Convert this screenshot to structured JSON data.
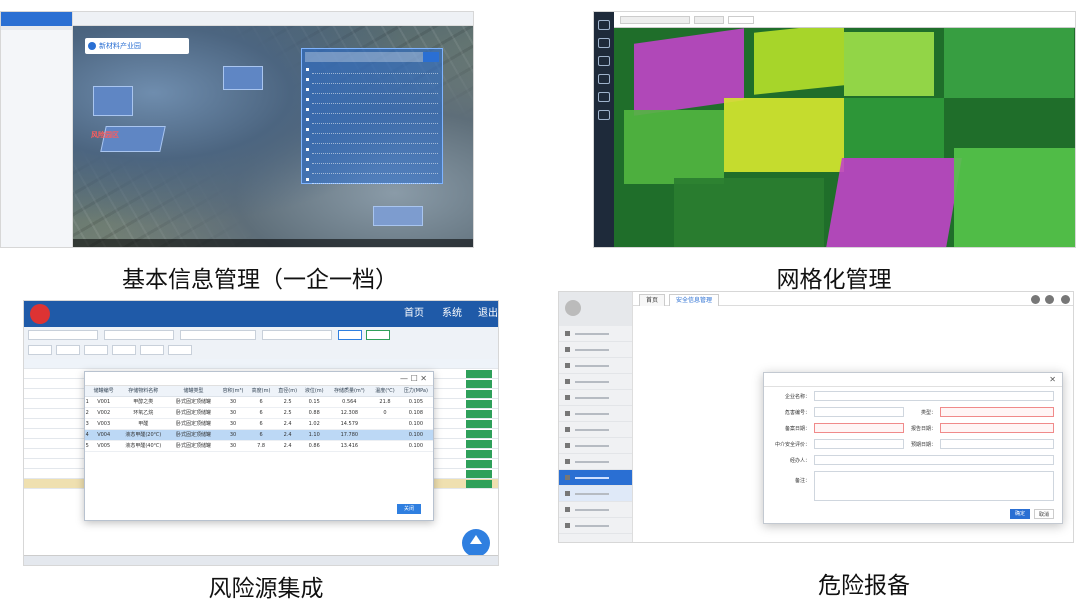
{
  "captions": {
    "basic_info": "基本信息管理（一企一档）",
    "grid": "网格化管理",
    "risk": "风险源集成",
    "hazard": "危险报备"
  },
  "panel1": {
    "park_name": "新材料产业园",
    "region_label": "风险园区"
  },
  "panel3": {
    "nav_home": "首页",
    "nav_system": "系统",
    "nav_logout": "退出",
    "dialog_columns": [
      "储罐编号",
      "存储物料名称",
      "储罐类型",
      "容积(m³)",
      "高度(m)",
      "直径(m)",
      "液位(m)",
      "存储质量(m³)",
      "温度(℃)",
      "压力(MPa)"
    ],
    "dialog_rows": [
      {
        "no": "1",
        "code": "V001",
        "material": "甲醇之类",
        "type": "卧式固定顶储罐",
        "vol": "30",
        "h": "6",
        "d": "2.5",
        "lvl": "0.15",
        "mass": "0.564",
        "temp": "21.8",
        "pres": "0.105"
      },
      {
        "no": "2",
        "code": "V002",
        "material": "环氧乙烷",
        "type": "卧式固定顶储罐",
        "vol": "30",
        "h": "6",
        "d": "2.5",
        "lvl": "0.88",
        "mass": "12.308",
        "temp": "0",
        "pres": "0.108"
      },
      {
        "no": "3",
        "code": "V003",
        "material": "甲醛",
        "type": "卧式固定顶储罐",
        "vol": "30",
        "h": "6",
        "d": "2.4",
        "lvl": "1.02",
        "mass": "14.579",
        "temp": "",
        "pres": "0.100"
      },
      {
        "no": "4",
        "code": "V004",
        "material": "液态甲醛(20℃)",
        "type": "卧式固定顶储罐",
        "vol": "30",
        "h": "6",
        "d": "2.4",
        "lvl": "1.10",
        "mass": "17.780",
        "temp": "",
        "pres": "0.100"
      },
      {
        "no": "5",
        "code": "V005",
        "material": "液态甲醛(40℃)",
        "type": "卧式固定顶储罐",
        "vol": "30",
        "h": "7.8",
        "d": "2.4",
        "lvl": "0.86",
        "mass": "13.416",
        "temp": "",
        "pres": "0.100"
      }
    ],
    "close_label": "关闭"
  },
  "panel4": {
    "tab_home": "首页",
    "tab_active": "安全信息管理",
    "dialog_labels": [
      "企业名称：",
      "危害编号：",
      "备案日期：",
      "中介安全评价：",
      "经办人：",
      "备注："
    ],
    "dialog_right_labels": [
      "类型：",
      "报告日期：",
      "预期日期："
    ],
    "confirm_label": "确定",
    "cancel_label": "取消"
  },
  "colors": {
    "primary_blue": "#2a6fd3",
    "header_blue": "#1f5aa8",
    "grid_green": "#1f6e2a",
    "zone_magenta": "#c044c8",
    "zone_lime": "#b6e02a"
  }
}
